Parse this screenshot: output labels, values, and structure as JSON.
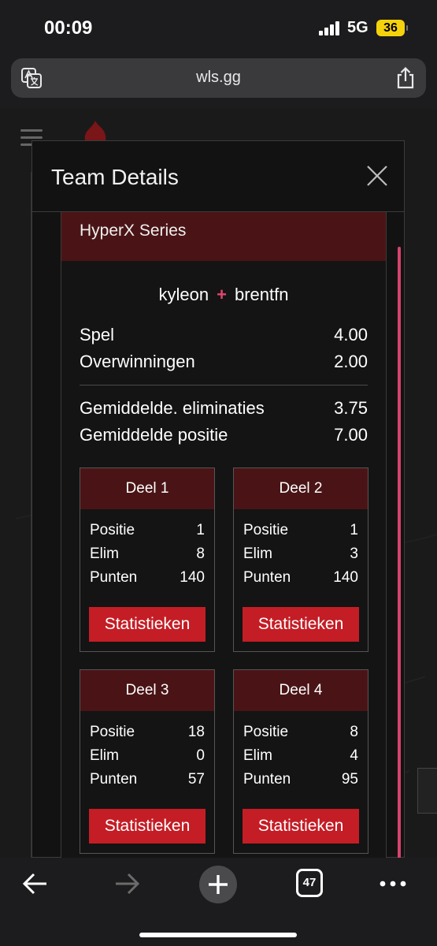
{
  "status": {
    "time": "00:09",
    "network": "5G",
    "battery": "36"
  },
  "browser": {
    "url": "wls.gg",
    "tab_count": "47"
  },
  "modal": {
    "title": "Team Details",
    "series": "HyperX Series",
    "players": [
      "kyleon",
      "brentfn"
    ],
    "plus": "+",
    "stats": [
      {
        "label": "Spel",
        "value": "4.00"
      },
      {
        "label": "Overwinningen",
        "value": "2.00"
      },
      {
        "label": "Gemiddelde. eliminaties",
        "value": "3.75"
      },
      {
        "label": "Gemiddelde positie",
        "value": "7.00"
      }
    ],
    "parts": [
      {
        "title": "Deel 1",
        "rows": [
          {
            "label": "Positie",
            "value": "1"
          },
          {
            "label": "Elim",
            "value": "8"
          },
          {
            "label": "Punten",
            "value": "140"
          }
        ],
        "button": "Statistieken"
      },
      {
        "title": "Deel 2",
        "rows": [
          {
            "label": "Positie",
            "value": "1"
          },
          {
            "label": "Elim",
            "value": "3"
          },
          {
            "label": "Punten",
            "value": "140"
          }
        ],
        "button": "Statistieken"
      },
      {
        "title": "Deel 3",
        "rows": [
          {
            "label": "Positie",
            "value": "18"
          },
          {
            "label": "Elim",
            "value": "0"
          },
          {
            "label": "Punten",
            "value": "57"
          }
        ],
        "button": "Statistieken"
      },
      {
        "title": "Deel 4",
        "rows": [
          {
            "label": "Positie",
            "value": "8"
          },
          {
            "label": "Elim",
            "value": "4"
          },
          {
            "label": "Punten",
            "value": "95"
          }
        ],
        "button": "Statistieken"
      }
    ]
  },
  "colors": {
    "accent_pink": "#e2466d",
    "header_maroon": "#4a1416",
    "button_red": "#c41d25"
  }
}
